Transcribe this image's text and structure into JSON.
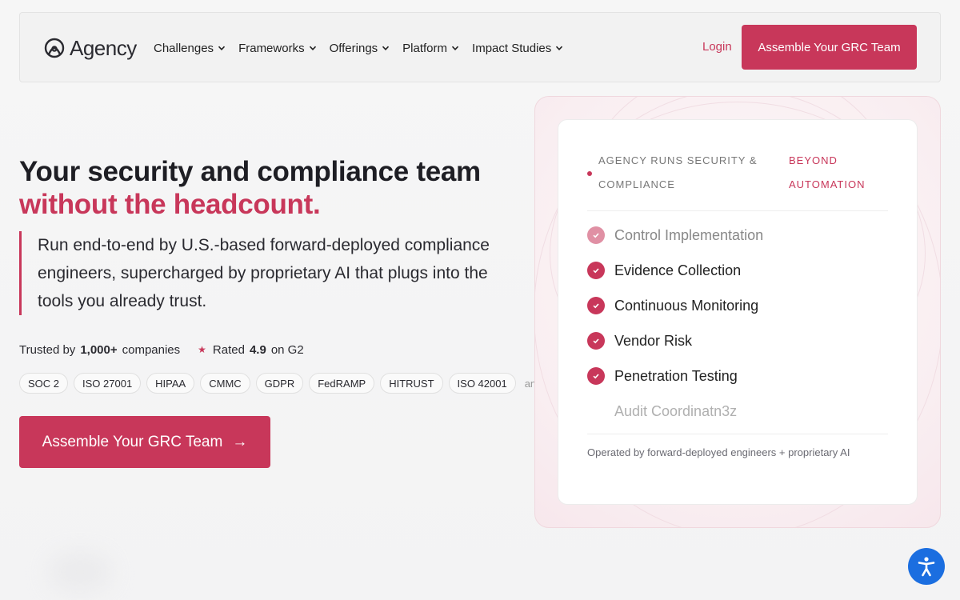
{
  "nav": {
    "logo_text": "Agency",
    "menu": [
      {
        "label": "Challenges"
      },
      {
        "label": "Frameworks"
      },
      {
        "label": "Offerings"
      },
      {
        "label": "Platform"
      },
      {
        "label": "Impact Studies"
      }
    ],
    "login_label": "Login",
    "cta_label": "Assemble Your GRC Team"
  },
  "hero": {
    "title_line1": "Your security and compliance team",
    "title_line2": "without the headcount.",
    "subtitle": "Run end-to-end by U.S.-based forward-deployed compliance engineers, supercharged by proprietary AI that plugs into the tools you already trust.",
    "trusted_prefix": "Trusted by",
    "trusted_count": "1,000+",
    "trusted_suffix": "companies",
    "rated_prefix": "Rated",
    "rating": "4.9",
    "rated_suffix": "on G2",
    "badges": [
      "SOC 2",
      "ISO 27001",
      "HIPAA",
      "CMMC",
      "GDPR",
      "FedRAMP",
      "HITRUST",
      "ISO 42001"
    ],
    "badges_more": "and m",
    "cta_label": "Assemble Your GRC Team",
    "cta_arrow": "→"
  },
  "card": {
    "head_left": "AGENCY RUNS SECURITY & COMPLIANCE",
    "head_right": "BEYOND AUTOMATION",
    "items": [
      {
        "label": "Control Implementation"
      },
      {
        "label": "Evidence Collection"
      },
      {
        "label": "Continuous Monitoring"
      },
      {
        "label": "Vendor Risk"
      },
      {
        "label": "Penetration Testing"
      },
      {
        "label": "Audit Coordinatn3z"
      }
    ],
    "footer": "Operated by forward-deployed engineers + proprietary AI"
  },
  "colors": {
    "accent": "#c8375a",
    "a11y_blue": "#1b6ee0"
  }
}
